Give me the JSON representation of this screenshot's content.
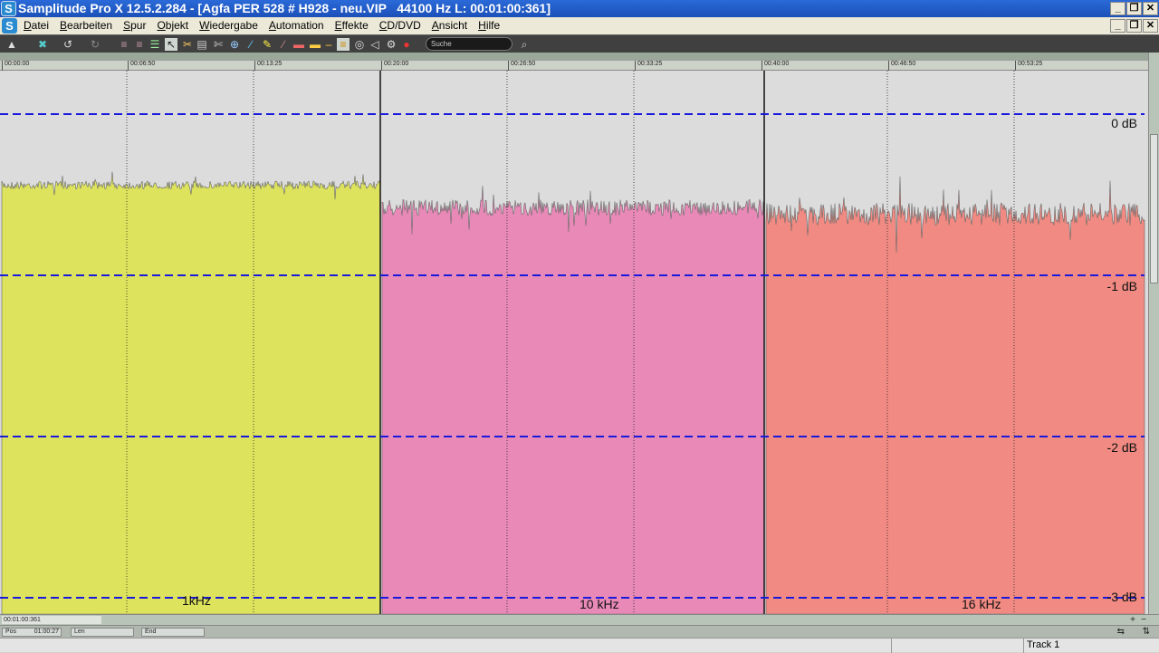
{
  "titlebar": {
    "app_icon": "S",
    "title": "Samplitude Pro X 12.5.2.284 - [Agfa PER 528 # H928 - neu.VIP   44100 Hz L: 00:01:00:361]",
    "buttons": [
      "_",
      "❒",
      "✕"
    ]
  },
  "menubar": {
    "app_icon": "S",
    "items": [
      {
        "label": "Datei",
        "accel": "D"
      },
      {
        "label": "Bearbeiten",
        "accel": "B"
      },
      {
        "label": "Spur",
        "accel": "S"
      },
      {
        "label": "Objekt",
        "accel": "O"
      },
      {
        "label": "Wiedergabe",
        "accel": "W"
      },
      {
        "label": "Automation",
        "accel": "A"
      },
      {
        "label": "Effekte",
        "accel": "E"
      },
      {
        "label": "CD/DVD",
        "accel": "C"
      },
      {
        "label": "Ansicht",
        "accel": "A"
      },
      {
        "label": "Hilfe",
        "accel": "H"
      }
    ],
    "buttons": [
      "_",
      "❒",
      "✕"
    ]
  },
  "toolbar": {
    "search_placeholder": "Suche",
    "icons": [
      "pointer-icon",
      "cross-icon",
      "undo-icon",
      "redo-icon",
      "grid-icon",
      "grid2-icon",
      "list-icon",
      "cursor-icon",
      "cut-icon",
      "paste-icon",
      "scissors-icon",
      "zoom-icon",
      "pencil-icon",
      "brush-icon",
      "edit-icon",
      "ruler-icon",
      "dash-icon",
      "marker-icon",
      "zoom2-icon",
      "loop-icon",
      "gear-icon",
      "record-icon",
      "search-icon"
    ]
  },
  "ruler": {
    "ticks": [
      "00:00:00",
      "00:06:50",
      "00:13:25",
      "00:20:00",
      "00:26:50",
      "00:33:25",
      "00:40:00",
      "00:46:50",
      "00:53:25"
    ]
  },
  "clips": [
    {
      "label": "1kHz",
      "color": "#dde35c",
      "level_db": -0.44,
      "variation_db": 0.05
    },
    {
      "label": "10 kHz",
      "color": "#e889b7",
      "level_db": -0.58,
      "variation_db": 0.1
    },
    {
      "label": "16 kHz",
      "color": "#f08a82",
      "level_db": -0.62,
      "variation_db": 0.14
    }
  ],
  "db_lines": {
    "color": "#1a1adc",
    "labels": [
      "0 dB",
      "-1 dB",
      "-2 dB",
      "-3 dB"
    ],
    "values": [
      0,
      -1,
      -2,
      -3
    ]
  },
  "statusbar": {
    "position_readout": "00:01:00:361",
    "pos_label": "Pos",
    "pos_value": "01:00:27",
    "len_label": "Len",
    "end_label": "End",
    "track_label": "Track 1"
  }
}
